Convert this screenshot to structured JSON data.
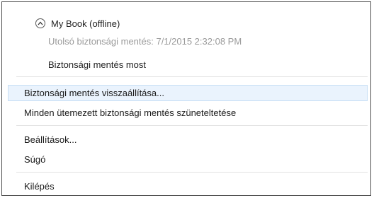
{
  "device": {
    "name": "My Book",
    "status": "(offline)",
    "title": "My Book  (offline)",
    "last_backup": "Utolsó biztonsági mentés: 7/1/2015 2:32:08 PM",
    "backup_now": "Biztonsági mentés most"
  },
  "menu": {
    "restore": "Biztonsági mentés visszaállítása...",
    "pause_all": "Minden ütemezett biztonsági mentés szüneteltetése",
    "settings": "Beállítások...",
    "help": "Súgó",
    "exit": "Kilépés"
  },
  "colors": {
    "highlight_bg": "#eaf3fd",
    "highlight_border": "#c7def5",
    "muted_text": "#9a9a9a"
  }
}
